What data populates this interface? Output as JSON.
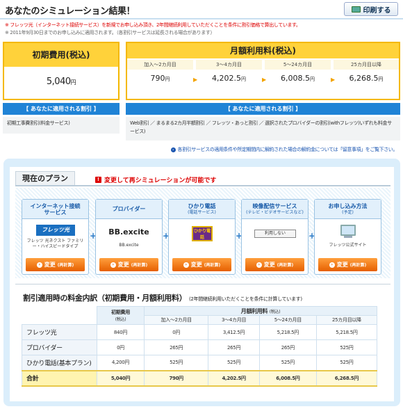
{
  "header": {
    "title": "あなたのシミュレーション結果！",
    "print_label": "印刷する"
  },
  "notes": {
    "line1": "※ フレッツ光（インターネット接続サービス）を新規でお申し込み頂き、2年間継続利用していただくことを条件に割引価格で算出しています。",
    "line2": "※ 2011年9月30日までのお申し込みに適用されます。（各割引サービスは延長される場合があります）"
  },
  "initial": {
    "heading": "初期費用(税込)",
    "value": "5,040",
    "unit": "円",
    "discount_label": "【 あなたに適用される割引 】",
    "discount_text": "初期工事費割引(料金サービス)"
  },
  "monthly": {
    "heading": "月額利用料(税込)",
    "periods": [
      {
        "label": "加入～2カ月目",
        "value": "790",
        "unit": "円"
      },
      {
        "label": "3～4カ月目",
        "value": "4,202.5",
        "unit": "円"
      },
      {
        "label": "5～24カ月目",
        "value": "6,008.5",
        "unit": "円"
      },
      {
        "label": "25カ月目以降",
        "value": "6,268.5",
        "unit": "円"
      }
    ],
    "discount_label": "【 あなたに適用される割引 】",
    "discount_text": "Web割引 ／ まるまる2カ月半額割引 ／ フレッツ・あっと割引 ／ 選択されたプロバイダーの割引(withフレッツ)いずれも料金サービス)"
  },
  "conditions_link": "各割引サービスの適用条件や所定期間内に解約された場合の解約金については「留意事項」をご覧下さい。",
  "plan": {
    "tab_label": "現在のプラン",
    "warning": "変更して再シミュレーションが可能です",
    "cards": [
      {
        "title": "インターネット接続サービス",
        "subtitle": "",
        "logo": "フレッツ光",
        "desc": "フレッツ 光ネクスト ファミリー・ハイスピードタイプ",
        "button": "変更",
        "button_sub": "(再計算)"
      },
      {
        "title": "プロバイダー",
        "subtitle": "",
        "logo": "BB.excite",
        "desc": "BB.excite",
        "button": "変更",
        "button_sub": "(再計算)"
      },
      {
        "title": "ひかり電話",
        "subtitle": "(電話サービス)",
        "logo": "ひかり電話",
        "desc": "",
        "button": "変更",
        "button_sub": "(再計算)"
      },
      {
        "title": "映像配信サービス",
        "subtitle": "(テレビ・ビデオサービスなど)",
        "logo": "利用しない",
        "desc": "",
        "button": "変更",
        "button_sub": "(再計算)"
      },
      {
        "title": "お申し込み方法",
        "subtitle": "(予定)",
        "logo": "",
        "desc": "フレッツ公式サイト",
        "button": "変更",
        "button_sub": "(再計算)"
      }
    ]
  },
  "breakdown": {
    "title": "割引適用時の料金内訳（初期費用・月額利用料）",
    "note": "(2年間継続利用いただくことを条件に計算しています)",
    "col_initial": "初期費用",
    "col_initial_sub": "(税込)",
    "col_monthly": "月額利用料",
    "col_monthly_sub": "(税込)",
    "periods": [
      "加入～2カ月目",
      "3～4カ月目",
      "5～24カ月目",
      "25カ月目以降"
    ],
    "rows": [
      {
        "label": "フレッツ光",
        "cells": [
          "840円",
          "0円",
          "3,412.5円",
          "5,218.5円",
          "5,218.5円"
        ]
      },
      {
        "label": "プロバイダー",
        "cells": [
          "0円",
          "265円",
          "265円",
          "265円",
          "525円"
        ]
      },
      {
        "label": "ひかり電話(基本プラン)",
        "cells": [
          "4,200円",
          "525円",
          "525円",
          "525円",
          "525円"
        ]
      },
      {
        "label": "合計",
        "cells": [
          "5,040円",
          "790円",
          "4,202.5円",
          "6,008.5円",
          "6,268.5円"
        ]
      }
    ]
  },
  "colors": {
    "accent_yellow": "#ffd23a",
    "accent_blue": "#1f83d6",
    "button_orange": "#f07a10",
    "warning_red": "#dd0000"
  }
}
